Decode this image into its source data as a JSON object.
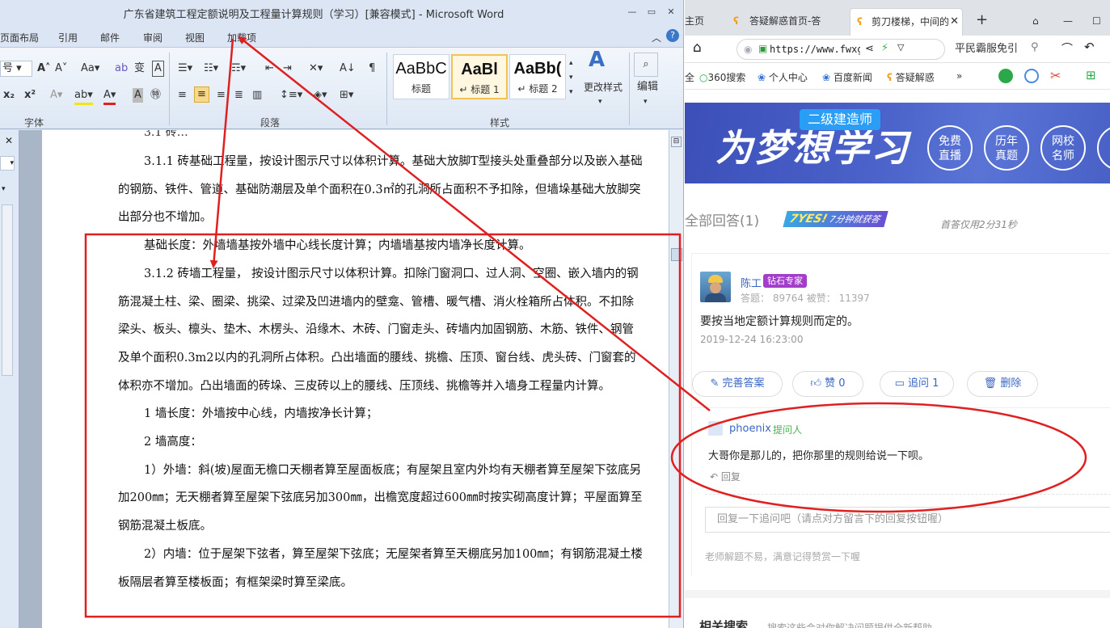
{
  "word": {
    "title": "广东省建筑工程定额说明及工程量计算规则（学习）[兼容模式] - Microsoft Word",
    "menu": [
      "页面布局",
      "引用",
      "邮件",
      "审阅",
      "视图",
      "加载项"
    ],
    "ribbon": {
      "font_group_label": "字体",
      "paragraph_group_label": "段落",
      "styles_group_label": "样式",
      "font_size_value": "号",
      "styles": [
        {
          "preview": "AaBbC",
          "label": "标题"
        },
        {
          "preview": "AaBl",
          "label": "↵ 标题 1"
        },
        {
          "preview": "AaBb(",
          "label": "↵ 标题 2"
        }
      ],
      "change_styles_label": "更改样式",
      "edit_label": "编辑"
    },
    "document": {
      "paragraphs": [
        "3.1.1 砖基础工程量，按设计图示尺寸以体积计算。基础大放脚T型接头处重叠部分以及嵌入基础的钢筋、铁件、管道、基础防潮层及单个面积在0.3㎡的孔洞所占面积不予扣除，但墙垛基础大放脚突出部分也不增加。",
        "基础长度：外墙墙基按外墙中心线长度计算；内墙墙基按内墙净长度计算。",
        "3.1.2 砖墙工程量， 按设计图示尺寸以体积计算。扣除门窗洞口、过人洞、空圈、嵌入墙内的钢筋混凝土柱、梁、圈梁、挑梁、过梁及凹进墙内的壁龛、管槽、暖气槽、消火栓箱所占体积。不扣除梁头、板头、檩头、垫木、木楞头、沿缘木、木砖、门窗走头、砖墙内加固钢筋、木筋、铁件、钢管及单个面积0.3m2以内的孔洞所占体积。凸出墙面的腰线、挑檐、压顶、窗台线、虎头砖、门窗套的体积亦不增加。凸出墙面的砖垛、三皮砖以上的腰线、压顶线、挑檐等并入墙身工程量内计算。",
        "1 墙长度：外墙按中心线，内墙按净长计算；",
        "2 墙高度：",
        "1）外墙：斜(坡)屋面无檐口天棚者算至屋面板底；有屋架且室内外均有天棚者算至屋架下弦底另加200㎜；无天棚者算至屋架下弦底另加300㎜，出檐宽度超过600㎜时按实砌高度计算；平屋面算至钢筋混凝土板底。",
        "2）内墙：位于屋架下弦者，算至屋架下弦底；无屋架者算至天棚底另加100㎜；有钢筋混凝土楼板隔层者算至楼板面；有框架梁时算至梁底。"
      ]
    }
  },
  "browser": {
    "tabs": [
      {
        "label": "主页"
      },
      {
        "label": "答疑解惑首页-答"
      },
      {
        "label": "剪刀楼梯，中间的"
      }
    ],
    "url": "https://www.fwxgx.c",
    "search_text": "平民霸服免引",
    "bookmarks": [
      "全",
      "360搜索",
      "个人中心",
      "百度新闻",
      "答疑解惑",
      "»"
    ],
    "banner": {
      "tag": "二级建造师",
      "main": "为梦想学习",
      "circles": [
        "免费\n直播",
        "历年\n真题",
        "网校\n名师"
      ]
    },
    "answers_header": {
      "all_answers": "全部回答(1)",
      "yes_badge": "7分钟就获答",
      "yes_word": "7YES!",
      "first_answer": "首答仅用2分31秒"
    },
    "answer": {
      "name": "陈工",
      "badge": "钻石专家",
      "stats": "答题： 89764   被赞： 11397",
      "text": "要按当地定额计算规则而定的。",
      "time": "2019-12-24 16:23:00",
      "actions": [
        "完善答案",
        "赞 0",
        "追问 1",
        "删除"
      ]
    },
    "followup": {
      "name": "phoenix",
      "role": "提问人",
      "text": "大哥你是那儿的，把你那里的规则给说一下呗。",
      "reply": "回复",
      "input_placeholder": "回复一下追问吧（请点对方留言下的回复按钮喔）",
      "tip": "老师解题不易，满意记得赞赏一下喔"
    },
    "related": "相关搜索",
    "related_sub": "搜索这些会对你解决问题提供全新帮助"
  },
  "annotation_color": "#e02020"
}
